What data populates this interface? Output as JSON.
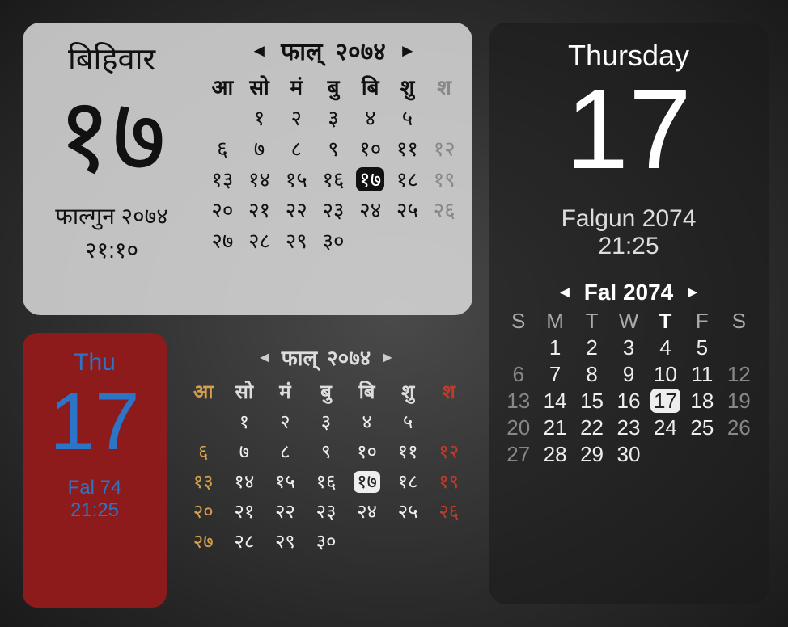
{
  "widgetA": {
    "dayName": "बिहिवार",
    "dayNum": "१७",
    "monthYear": "फाल्गुन २०७४",
    "time": "२१:१०",
    "navMonth": "फाल्",
    "navYear": "२०७४",
    "prev": "◄",
    "next": "►",
    "weekdays": [
      "आ",
      "सो",
      "मं",
      "बु",
      "बि",
      "शु",
      "श"
    ],
    "todayCol": 4,
    "weeks": [
      [
        "",
        "१",
        "२",
        "३",
        "४",
        "५",
        ""
      ],
      [
        "६",
        "७",
        "८",
        "९",
        "१०",
        "११",
        "१२"
      ],
      [
        "१३",
        "१४",
        "१५",
        "१६",
        "१७",
        "१८",
        "१९"
      ],
      [
        "२०",
        "२१",
        "२२",
        "२३",
        "२४",
        "२५",
        "२६"
      ],
      [
        "२७",
        "२८",
        "२९",
        "३०",
        "",
        "",
        ""
      ]
    ],
    "todayValue": "१७"
  },
  "widgetB": {
    "dayName": "Thu",
    "dayNum": "17",
    "monthYear": "Fal 74",
    "time": "21:25"
  },
  "widgetC": {
    "navMonth": "फाल्",
    "navYear": "२०७४",
    "prev": "◄",
    "next": "►",
    "weekdays": [
      "आ",
      "सो",
      "मं",
      "बु",
      "बि",
      "शु",
      "श"
    ],
    "weeks": [
      [
        "",
        "१",
        "२",
        "३",
        "४",
        "५",
        ""
      ],
      [
        "६",
        "७",
        "८",
        "९",
        "१०",
        "११",
        "१२"
      ],
      [
        "१३",
        "१४",
        "१५",
        "१६",
        "१७",
        "१८",
        "१९"
      ],
      [
        "२०",
        "२१",
        "२२",
        "२३",
        "२४",
        "२५",
        "२६"
      ],
      [
        "२७",
        "२८",
        "२९",
        "३०",
        "",
        "",
        ""
      ]
    ],
    "todayValue": "१७"
  },
  "widgetD": {
    "dayName": "Thursday",
    "dayNum": "17",
    "monthYear": "Falgun 2074",
    "time": "21:25",
    "navLabel": "Fal 2074",
    "prev": "◄",
    "next": "►",
    "weekdays": [
      "S",
      "M",
      "T",
      "W",
      "T",
      "F",
      "S"
    ],
    "todayCol": 4,
    "weeks": [
      [
        "",
        "1",
        "2",
        "3",
        "4",
        "5",
        ""
      ],
      [
        "6",
        "7",
        "8",
        "9",
        "10",
        "11",
        "12"
      ],
      [
        "13",
        "14",
        "15",
        "16",
        "17",
        "18",
        "19"
      ],
      [
        "20",
        "21",
        "22",
        "23",
        "24",
        "25",
        "26"
      ],
      [
        "27",
        "28",
        "29",
        "30",
        "",
        "",
        ""
      ]
    ],
    "todayValue": "17"
  }
}
